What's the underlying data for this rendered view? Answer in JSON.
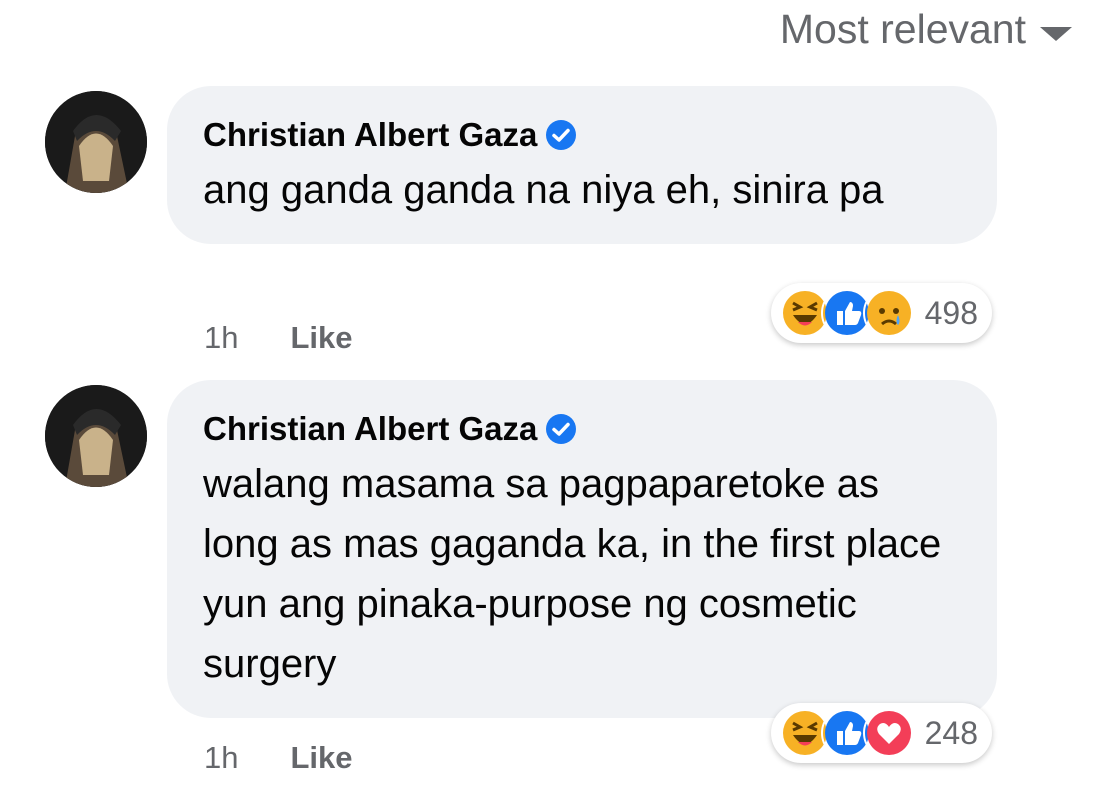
{
  "sort": {
    "label": "Most relevant"
  },
  "comments": [
    {
      "author": "Christian Albert Gaza",
      "text": "ang ganda ganda na niya eh, sinira pa",
      "reactions": [
        "haha",
        "like",
        "sad"
      ],
      "reaction_count": "498",
      "time": "1h",
      "like_label": "Like"
    },
    {
      "author": "Christian Albert Gaza",
      "text": "walang masama sa pagpaparetoke as long as mas gaganda ka, in the first place yun ang pinaka-purpose ng cosmetic surgery",
      "reactions": [
        "haha",
        "like",
        "love"
      ],
      "reaction_count": "248",
      "time": "1h",
      "like_label": "Like"
    }
  ],
  "colors": {
    "verified": "#1877f2",
    "like": "#1877f2",
    "love": "#f33e58",
    "haha": "#f7b125",
    "bubble": "#f0f2f5",
    "meta": "#65676b"
  }
}
